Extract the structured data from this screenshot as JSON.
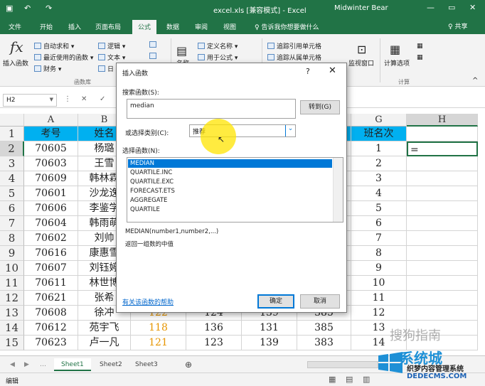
{
  "titlebar": {
    "title": "excel.xls  [兼容模式]  -  Excel",
    "user": "Midwinter Bear",
    "qa_save_icon": "save-icon",
    "qa_undo": "↶",
    "qa_redo": "↷",
    "minimize": "—",
    "restore": "▭",
    "close": "✕"
  },
  "tabs": [
    "文件",
    "开始",
    "插入",
    "页面布局",
    "公式",
    "数据",
    "审阅",
    "视图"
  ],
  "active_tab": "公式",
  "tellme": "♀ 告诉我你想要做什么",
  "share": "♀ 共享",
  "ribbon": {
    "insert_function": "插入函数",
    "autosum": "自动求和",
    "recent": "最近使用的函数",
    "finance": "财务",
    "logic": "逻辑",
    "text": "文本",
    "date_partial": "日",
    "define_name": "定义名称",
    "use_in_formula": "用于公式",
    "name_mgr_partial": "名称",
    "trace_prec": "追踪引用单元格",
    "trace_dep": "追踪从属单元格",
    "watch": "监视窗口",
    "calc_options": "计算选项",
    "group_library": "函数库",
    "group_calc": "计算"
  },
  "formula_bar": {
    "name_box": "H2",
    "cancel": "✕",
    "enter": "✓"
  },
  "grid": {
    "columns": [
      "A",
      "B",
      "C",
      "D",
      "E",
      "F",
      "G",
      "H"
    ],
    "rows": [
      "1",
      "2",
      "3",
      "4",
      "5",
      "6",
      "7",
      "8",
      "9",
      "10",
      "11",
      "12",
      "13",
      "14",
      "15"
    ],
    "header_row": {
      "A": "考号",
      "B": "姓名",
      "G": "班名次"
    },
    "col_a": [
      "70605",
      "70603",
      "70609",
      "70601",
      "70606",
      "70604",
      "70602",
      "70616",
      "70607",
      "70611",
      "70621",
      "70608",
      "70612",
      "70623"
    ],
    "col_b": [
      "杨璐",
      "王雪",
      "韩林霖",
      "沙龙逸",
      "李鉴学",
      "韩雨萌",
      "刘帅",
      "康惠雪",
      "刘钰婷",
      "林世博",
      "张希",
      "徐冲",
      "苑宇飞",
      "卢一凡"
    ],
    "col_g": [
      "1",
      "2",
      "3",
      "4",
      "5",
      "6",
      "7",
      "8",
      "9",
      "10",
      "11",
      "12",
      "13",
      "14"
    ],
    "col_h_active": "=",
    "bottom_rows": [
      {
        "c": "122",
        "d": "124",
        "e": "139",
        "f": "385"
      },
      {
        "c": "118",
        "d": "136",
        "e": "131",
        "f": "385"
      },
      {
        "c": "121",
        "d": "123",
        "e": "139",
        "f": "383"
      }
    ],
    "header_color": "#00b0f0",
    "orange_text": "#e69500"
  },
  "dialog": {
    "title": "插入函数",
    "help_q": "?",
    "close": "✕",
    "search_label": "搜索函数(S):",
    "search_value": "median",
    "go_button": "转到(G)",
    "category_label": "或选择类别(C):",
    "category_value": "推荐",
    "select_label": "选择函数(N):",
    "functions": [
      "MEDIAN",
      "QUARTILE.INC",
      "QUARTILE.EXC",
      "FORECAST.ETS",
      "AGGREGATE",
      "QUARTILE"
    ],
    "selected_index": 0,
    "signature": "MEDIAN(number1,number2,...)",
    "description": "返回一组数的中值",
    "help_link": "有关该函数的帮助",
    "ok": "确定",
    "cancel": "取消"
  },
  "sheets": [
    "Sheet1",
    "Sheet2",
    "Sheet3"
  ],
  "active_sheet": "Sheet1",
  "status": {
    "mode": "编辑"
  },
  "watermark": {
    "line1": "搜狗指南",
    "brand": "系统城",
    "line3": "织梦内容管理系统",
    "line4": "DEDECMS.COM"
  },
  "accent": "#217346"
}
